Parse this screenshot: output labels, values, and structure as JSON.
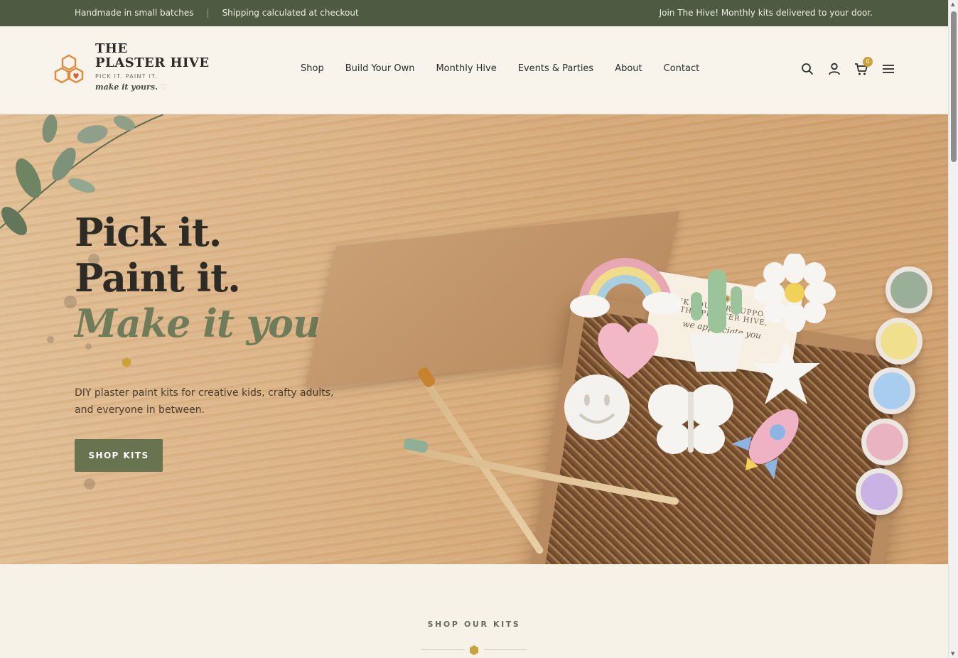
{
  "announcement": {
    "left_items": [
      "Handmade in small batches",
      "Shipping calculated at checkout"
    ],
    "separator": "|",
    "right_text": "Join The Hive! Monthly kits delivered to your door."
  },
  "brand": {
    "line1": "THE",
    "line2": "PLASTER HIVE",
    "tagline": "PICK IT. PAINT IT.",
    "script": "make it yours.",
    "heart": "♡",
    "logo_icon": "honeycomb-heart-icon"
  },
  "nav": {
    "items": [
      "Shop",
      "Build Your Own",
      "Monthly Hive",
      "Events & Parties",
      "About",
      "Contact"
    ]
  },
  "header_icons": {
    "search": "search-icon",
    "account": "user-icon",
    "cart": "cart-icon",
    "cart_count": "0",
    "menu": "hamburger-icon"
  },
  "hero": {
    "line1": "Pick it.",
    "line2": "Paint it.",
    "line3": "Make it yours.",
    "subtitle": "DIY plaster paint kits for creative kids, crafty adults, and everyone in between.",
    "cta": "SHOP KITS",
    "card": {
      "line1": "THANK YOU FOR SUPPORTING",
      "line2": "THE PLASTER HIVE,",
      "line3": "we appreciate you"
    }
  },
  "section": {
    "title": "SHOP OUR KITS"
  },
  "colors": {
    "topbar": "#4f5a42",
    "accent_green": "#68734f",
    "gold": "#c9a23a",
    "orange": "#e08a3a",
    "background": "#f7f2e8"
  }
}
